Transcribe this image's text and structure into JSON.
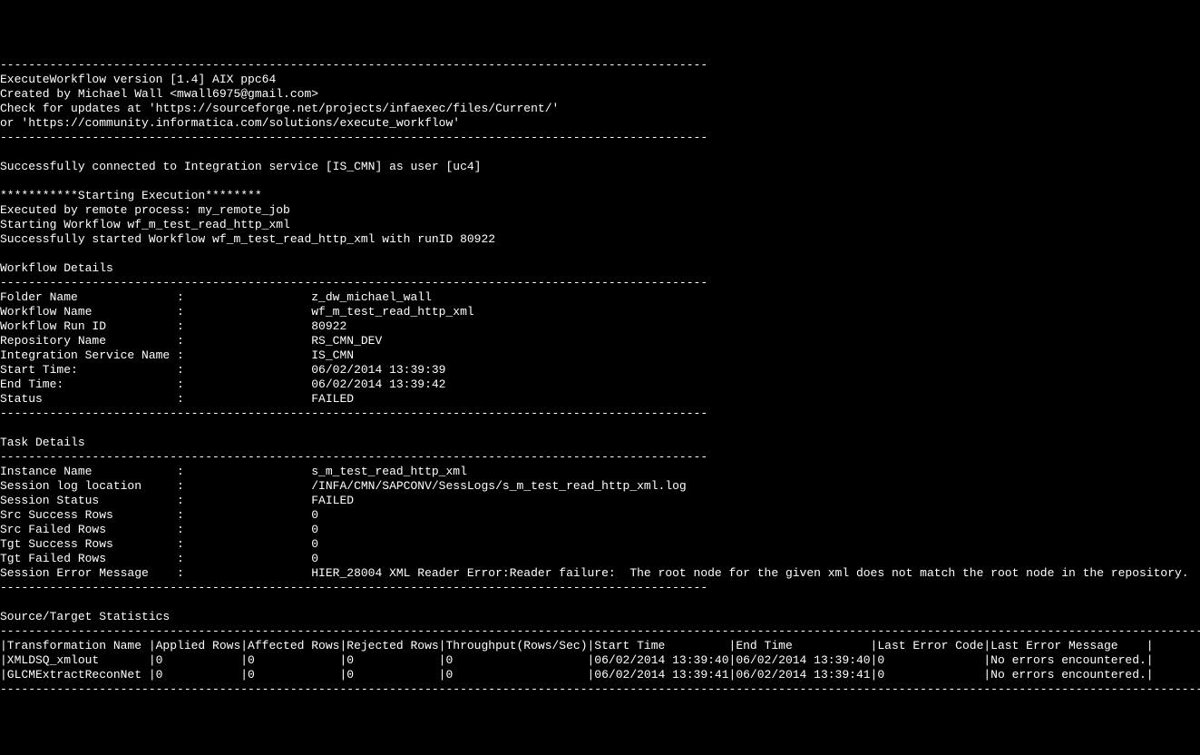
{
  "header": {
    "hr": "----------------------------------------------------------------------------------------------------",
    "line1": "ExecuteWorkflow version [1.4] AIX ppc64",
    "line2": "Created by Michael Wall <mwall6975@gmail.com>",
    "line3": "Check for updates at 'https://sourceforge.net/projects/infaexec/files/Current/'",
    "line4": "or 'https://community.informatica.com/solutions/execute_workflow'"
  },
  "connect": {
    "line": "Successfully connected to Integration service [IS_CMN] as user [uc4]"
  },
  "exec": {
    "banner": "***********Starting Execution********",
    "line1": "Executed by remote process: my_remote_job",
    "line2": "Starting Workflow wf_m_test_read_http_xml",
    "line3": "Successfully started Workflow wf_m_test_read_http_xml with runID 80922"
  },
  "wfdetails": {
    "title": "Workflow Details",
    "hr": "----------------------------------------------------------------------------------------------------",
    "rows": [
      {
        "label": "Folder Name             ",
        "value": "z_dw_michael_wall"
      },
      {
        "label": "Workflow Name           ",
        "value": "wf_m_test_read_http_xml"
      },
      {
        "label": "Workflow Run ID         ",
        "value": "80922"
      },
      {
        "label": "Repository Name         ",
        "value": "RS_CMN_DEV"
      },
      {
        "label": "Integration Service Name",
        "value": "IS_CMN"
      },
      {
        "label": "Start Time:             ",
        "value": "06/02/2014 13:39:39"
      },
      {
        "label": "End Time:               ",
        "value": "06/02/2014 13:39:42"
      },
      {
        "label": "Status                  ",
        "value": "FAILED"
      }
    ]
  },
  "taskdetails": {
    "title": "Task Details",
    "hr": "----------------------------------------------------------------------------------------------------",
    "rows": [
      {
        "label": "Instance Name           ",
        "value": "s_m_test_read_http_xml"
      },
      {
        "label": "Session log location    ",
        "value": "/INFA/CMN/SAPCONV/SessLogs/s_m_test_read_http_xml.log"
      },
      {
        "label": "Session Status          ",
        "value": "FAILED"
      },
      {
        "label": "Src Success Rows        ",
        "value": "0"
      },
      {
        "label": "Src Failed Rows         ",
        "value": "0"
      },
      {
        "label": "Tgt Success Rows        ",
        "value": "0"
      },
      {
        "label": "Tgt Failed Rows         ",
        "value": "0"
      },
      {
        "label": "Session Error Message   ",
        "value": "HIER_28004 XML Reader Error:Reader failure:  The root node for the given xml does not match the root node in the repository."
      }
    ]
  },
  "stats": {
    "title": "Source/Target Statistics",
    "hr_long": "-----------------------------------------------------------------------------------------------------------------------------------------------------------------------------------------",
    "header": "|Transformation Name |Applied Rows|Affected Rows|Rejected Rows|Throughput(Rows/Sec)|Start Time         |End Time           |Last Error Code|Last Error Message    |",
    "rows": [
      "|XMLDSQ_xmlout       |0           |0            |0            |0                   |06/02/2014 13:39:40|06/02/2014 13:39:40|0              |No errors encountered.|",
      "|GLCMExtractReconNet |0           |0            |0            |0                   |06/02/2014 13:39:41|06/02/2014 13:39:41|0              |No errors encountered.|"
    ]
  }
}
